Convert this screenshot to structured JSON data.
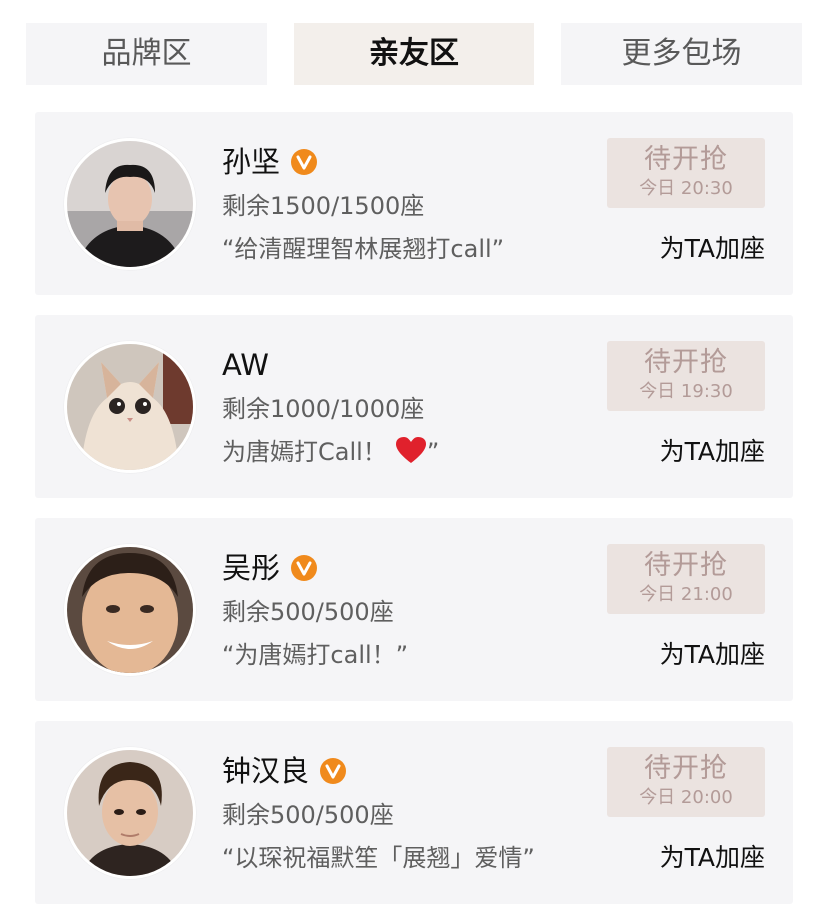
{
  "tabs": [
    {
      "label": "品牌区"
    },
    {
      "label": "亲友区"
    },
    {
      "label": "更多包场"
    }
  ],
  "cards": [
    {
      "name": "孙坚",
      "seats": "剩余1500/1500座",
      "slogan": "“给清醒理智林展翘打call”",
      "grab_label": "待开抢",
      "time": "今日 20:30",
      "action": "为TA加座"
    },
    {
      "name": "AW",
      "seats": "剩余1000/1000座",
      "slogan": "为唐嫣打Call！",
      "slogan_end": "”",
      "grab_label": "待开抢",
      "time": "今日 19:30",
      "action": "为TA加座"
    },
    {
      "name": "吴彤",
      "seats": "剩余500/500座",
      "slogan": "“为唐嫣打call！”",
      "grab_label": "待开抢",
      "time": "今日 21:00",
      "action": "为TA加座"
    },
    {
      "name": "钟汉良",
      "seats": "剩余500/500座",
      "slogan": "“以琛祝福默笙「展翘」爱情”",
      "grab_label": "待开抢",
      "time": "今日 20:00",
      "action": "为TA加座"
    }
  ],
  "colors": {
    "verified_badge": "#f08a1c",
    "grab_bg": "#ebe3e0",
    "grab_text": "#b39b98",
    "active_tab_bg": "#f3efeb"
  },
  "icons": {
    "verified": "verified-v-badge-icon",
    "heart": "red-heart-icon"
  }
}
